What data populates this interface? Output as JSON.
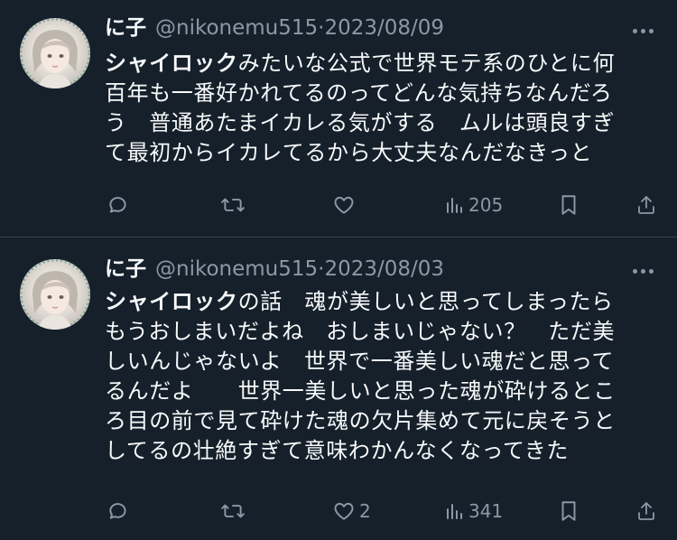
{
  "tweets": [
    {
      "name": "に子",
      "handle": "@nikonemu515",
      "separator": "·",
      "date": "2023/08/09",
      "body_bold": "シャイロック",
      "body_lines": [
        "みたいな公式で世界モテ系のひとに何",
        "百年も一番好かれてるのってどんな気持ちなんだろ",
        "う　普通あたまイカレる気がする　ムルは頭良すぎ",
        "て最初からイカレてるから大丈夫なんだなきっと"
      ],
      "reply_count": "",
      "retweet_count": "",
      "like_count": "",
      "view_count": "205"
    },
    {
      "name": "に子",
      "handle": "@nikonemu515",
      "separator": "·",
      "date": "2023/08/03",
      "body_bold": "シャイロック",
      "body_lines": [
        "の話　魂が美しいと思ってしまったら",
        "もうおしまいだよね　おしまいじゃない？　ただ美",
        "しいんじゃないよ　世界で一番美しい魂だと思って",
        "るんだよ　　世界一美しいと思った魂が砕けるとこ",
        "ろ目の前で見て砕けた魂の欠片集めて元に戻そうと",
        "してるの壮絶すぎて意味わかんなくなってきた"
      ],
      "reply_count": "",
      "retweet_count": "",
      "like_count": "2",
      "view_count": "341"
    }
  ],
  "icons": [
    "reply-icon",
    "retweet-icon",
    "like-icon",
    "views-icon",
    "bookmark-icon",
    "share-icon",
    "more-icon"
  ],
  "colors": {
    "background": "#15202b",
    "text": "#f7f9f9",
    "muted": "#8b98a5",
    "divider": "#38444d"
  }
}
